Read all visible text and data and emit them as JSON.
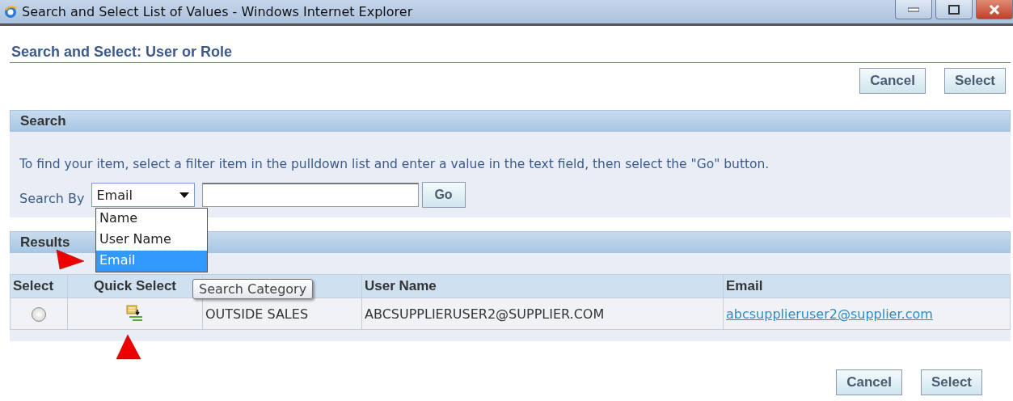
{
  "window": {
    "title": "Search and Select List of Values - Windows Internet Explorer"
  },
  "page_title": "Search and Select: User or Role",
  "top_buttons": [
    "Cancel",
    "Select"
  ],
  "search": {
    "header": "Search",
    "instructions": "To find your item, select a filter item in the pulldown list and enter a value in the text field, then select the \"Go\" button.",
    "label": "Search By",
    "filter_value": "Email",
    "dropdown_options": [
      {
        "label": "Name",
        "selected": false
      },
      {
        "label": "User Name",
        "selected": false
      },
      {
        "label": "Email",
        "selected": true
      }
    ],
    "go_button": "Go"
  },
  "results": {
    "header": "Results",
    "tooltip": "Search Category",
    "columns": [
      "Select",
      "Quick Select",
      "User Name",
      "Email"
    ],
    "rows": [
      {
        "selected": false,
        "column_3": "OUTSIDE SALES",
        "user_name": "ABCSUPPLIERUSER2@SUPPLIER.COM",
        "email": "abcsupplieruser2@supplier.com"
      }
    ]
  },
  "bottom_buttons": [
    "Cancel",
    "Select"
  ]
}
